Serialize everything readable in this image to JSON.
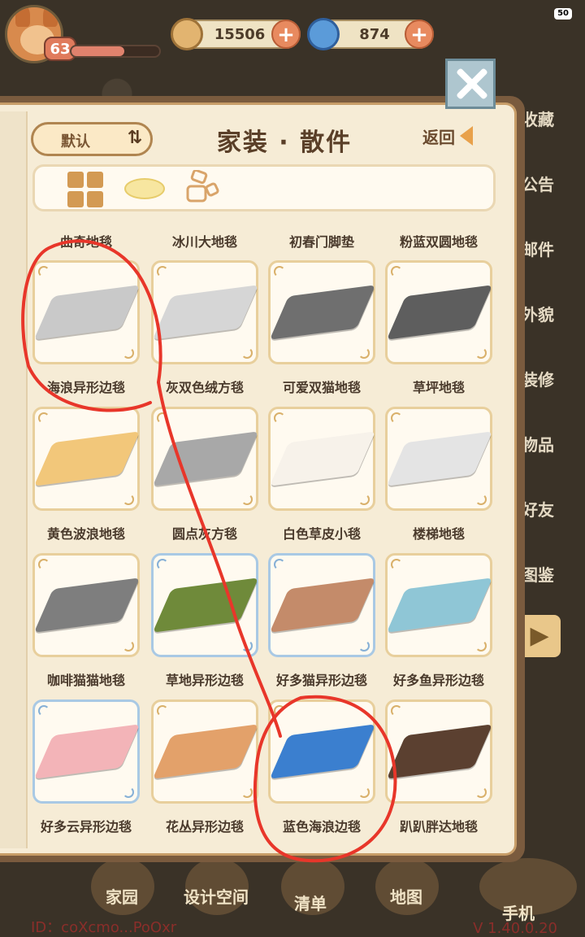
{
  "hud": {
    "level": "63",
    "hp_fraction": 0.6,
    "coins": "15506",
    "gems": "874",
    "status": "50"
  },
  "side_menu": [
    "收藏",
    "公告",
    "邮件",
    "外貌",
    "装修",
    "物品",
    "好友",
    "图鉴"
  ],
  "bottom_bar": {
    "items": [
      "家园",
      "设计空间",
      "清单",
      "地图",
      "手机"
    ],
    "id_text": "ID：coXcmo...PoOxr",
    "version": "V 1.40.0.20"
  },
  "panel": {
    "sort_label": "默认",
    "title": "家装 · 散件",
    "back_label": "返回"
  },
  "top_row_labels": [
    "曲奇地毯",
    "冰川大地毯",
    "初春门脚垫",
    "粉蓝双圆地毯"
  ],
  "items": [
    {
      "name": "海浪异形边毯",
      "color": "#c9c9c9",
      "frame": "gold"
    },
    {
      "name": "灰双色绒方毯",
      "color": "#d6d6d6",
      "frame": "gold"
    },
    {
      "name": "可爱双猫地毯",
      "color": "#6f6f6f",
      "frame": "gold"
    },
    {
      "name": "草坪地毯",
      "color": "#5e5e5e",
      "frame": "gold"
    },
    {
      "name": "黄色波浪地毯",
      "color": "#f2c77a",
      "frame": "gold"
    },
    {
      "name": "圆点灰方毯",
      "color": "#a8a8a8",
      "frame": "gold"
    },
    {
      "name": "白色草皮小毯",
      "color": "#f7f2ea",
      "frame": "gold"
    },
    {
      "name": "楼梯地毯",
      "color": "#e4e4e4",
      "frame": "gold"
    },
    {
      "name": "咖啡猫猫地毯",
      "color": "#7e7e7e",
      "frame": "gold"
    },
    {
      "name": "草地异形边毯",
      "color": "#6f8a3a",
      "frame": "blue"
    },
    {
      "name": "好多猫异形边毯",
      "color": "#c48b6a",
      "frame": "blue"
    },
    {
      "name": "好多鱼异形边毯",
      "color": "#8fc6d6",
      "frame": "gold"
    },
    {
      "name": "好多云异形边毯",
      "color": "#f3b4b8",
      "frame": "blue"
    },
    {
      "name": "花丛异形边毯",
      "color": "#e3a16a",
      "frame": "gold"
    },
    {
      "name": "蓝色海浪边毯",
      "color": "#3b7fcf",
      "frame": "gold"
    },
    {
      "name": "趴趴胖达地毯",
      "color": "#5b4030",
      "frame": "gold"
    }
  ]
}
